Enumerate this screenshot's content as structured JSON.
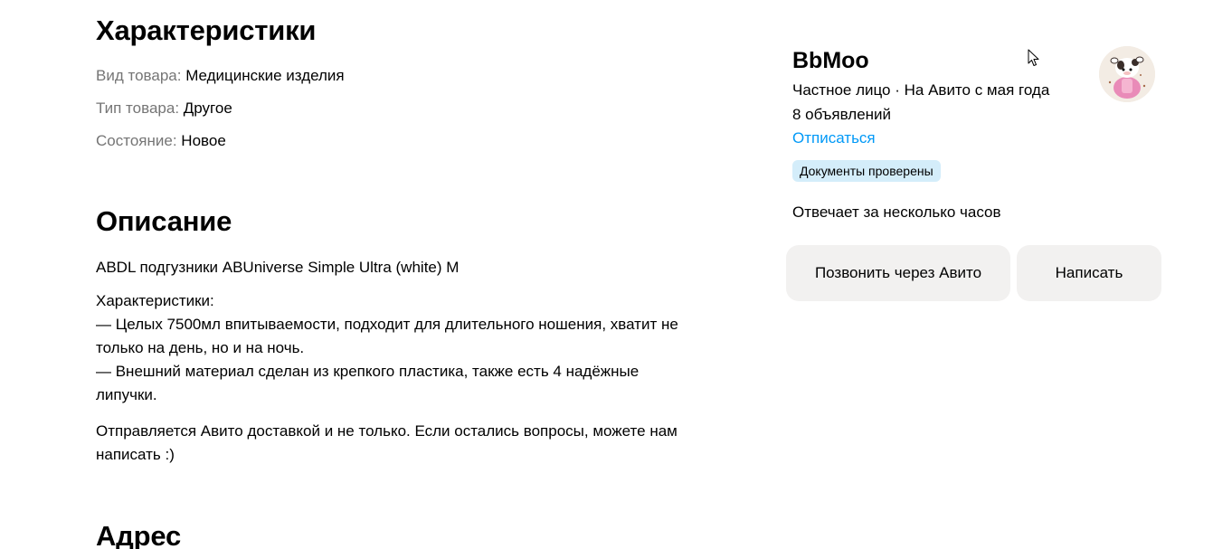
{
  "characteristics": {
    "title": "Характеристики",
    "items": [
      {
        "label": "Вид товара:",
        "value": "Медицинские изделия"
      },
      {
        "label": "Тип товара:",
        "value": "Другое"
      },
      {
        "label": "Состояние:",
        "value": "Новое"
      }
    ]
  },
  "description": {
    "title": "Описание",
    "paragraph1": "ABDL подгузники ABUniverse Simple Ultra (white) M",
    "paragraph2_lines": [
      "Характеристики:",
      "— Целых 7500мл впитываемости, подходит для длительного ношения, хватит не",
      "только на день, но и на ночь.",
      "— Внешний материал сделан из крепкого пластика, также есть 4 надёжные",
      "липучки."
    ],
    "paragraph3_lines": [
      "Отправляется Авито доставкой и не только. Если остались вопросы, можете нам",
      "написать :)"
    ]
  },
  "address": {
    "title": "Адрес"
  },
  "seller": {
    "name": "BbMoo",
    "meta": "Частное лицо · На Авито с мая года",
    "ads_count": "8 объявлений",
    "unsubscribe_label": "Отписаться",
    "verified_badge": "Документы проверены",
    "reply_time": "Отвечает за несколько часов",
    "call_button": "Позвонить через Авито",
    "write_button": "Написать"
  },
  "colors": {
    "link": "#0099f7",
    "badge_bg": "#d4edfa",
    "button_bg": "#f2f1f0",
    "label_gray": "#757575"
  }
}
